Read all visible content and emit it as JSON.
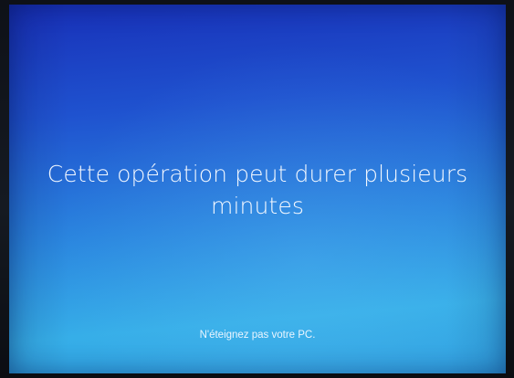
{
  "update_screen": {
    "message_lines": [
      "Cette opération peut durer plusieurs",
      "minutes"
    ],
    "footnote": "N'éteignez pas votre PC."
  },
  "colors": {
    "screen_top": "#1830b8",
    "screen_bottom": "#36aee8",
    "text": "#f3f8ff",
    "bezel": "#0e1118"
  }
}
